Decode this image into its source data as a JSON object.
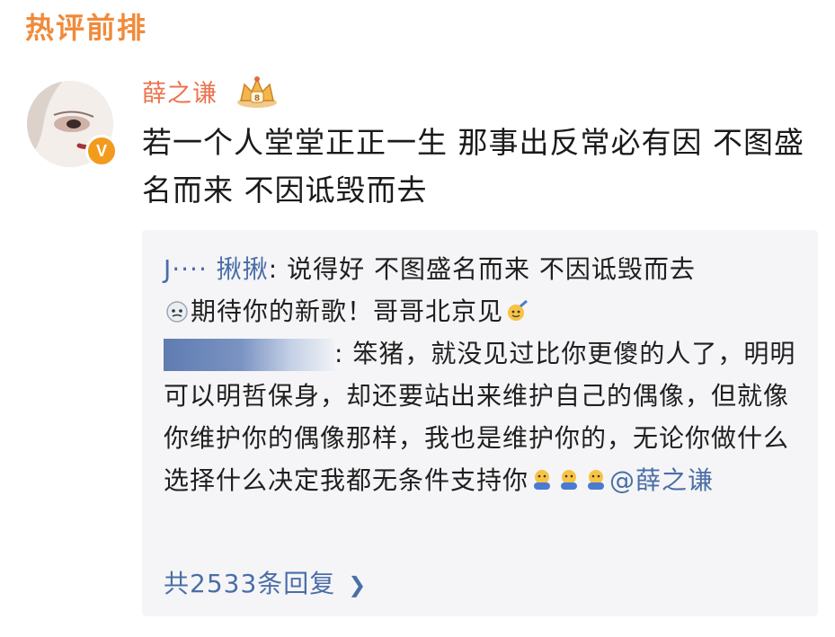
{
  "section": {
    "title": "热评前排"
  },
  "comment": {
    "author": "薛之谦",
    "text": "若一个人堂堂正正一生 那事出反常必有因 不图盛名而来 不因诋毁而去"
  },
  "replies": [
    {
      "author": "J···· 揪揪",
      "separator": ": ",
      "text_part1": "说得好 不图盛名而来 不因诋毁而去",
      "text_part2": "期待你的新歌！哥哥北京见"
    },
    {
      "separator": ": ",
      "text": "笨猪，就没见过比你更傻的人了，明明可以明哲保身，却还要站出来维护自己的偶像，但就像你维护你的偶像那样，我也是维护你的，无论你做什么选择什么决定我都无条件支持你",
      "mention": "@薛之谦"
    }
  ],
  "more_replies": {
    "label": "共2533条回复"
  },
  "colors": {
    "accent_orange": "#f08a3a",
    "name_orange": "#eb7350",
    "link_blue": "#4a6ea7",
    "reply_bg": "#f5f5f7"
  },
  "icons": [
    "verified-icon",
    "crown-icon",
    "chevron-right-icon",
    "emoji-sweat-icon",
    "emoji-celebrate-icon",
    "emoji-hug-icon"
  ]
}
